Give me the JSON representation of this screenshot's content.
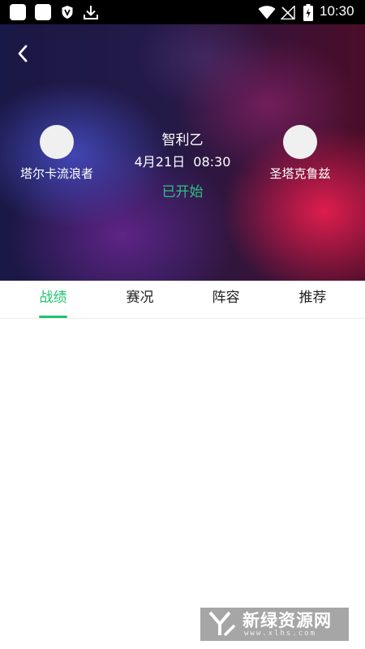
{
  "status_bar": {
    "time": "10:30",
    "icons": [
      "app-square-icon",
      "app-square-icon",
      "shield-icon",
      "download-icon",
      "wifi-icon",
      "signal-off-icon",
      "battery-charging-icon"
    ]
  },
  "header": {
    "back_icon": "chevron-left-icon",
    "league": "智利乙",
    "datetime": "4月21日  08:30",
    "status": "已开始",
    "home_team": {
      "name": "塔尔卡流浪者"
    },
    "away_team": {
      "name": "圣塔克鲁兹"
    }
  },
  "tabs": [
    {
      "label": "战绩",
      "active": true
    },
    {
      "label": "赛况",
      "active": false
    },
    {
      "label": "阵容",
      "active": false
    },
    {
      "label": "推荐",
      "active": false
    }
  ],
  "watermark": {
    "text": "新绿资源网",
    "url": "www.xlhs.com"
  },
  "colors": {
    "accent": "#1fc36f",
    "status_green": "#2ec27e",
    "status_bar_bg": "#000000"
  }
}
